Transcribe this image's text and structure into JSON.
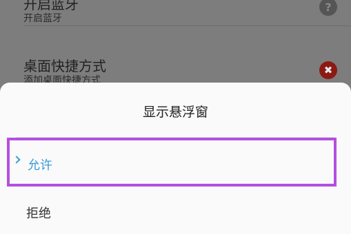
{
  "settings": {
    "bluetooth": {
      "title": "开启蓝牙",
      "subtitle": "开启蓝牙",
      "help_icon": "?"
    },
    "shortcut": {
      "title": "桌面快捷方式",
      "subtitle": "添加桌面快捷方式",
      "status_icon": "✖"
    }
  },
  "dialog": {
    "title": "显示悬浮窗",
    "options": [
      {
        "label": "允许",
        "selected": true
      },
      {
        "label": "拒绝",
        "selected": false
      }
    ],
    "highlight_color": "#b44fe0",
    "accent_color": "#3a9ad9"
  }
}
